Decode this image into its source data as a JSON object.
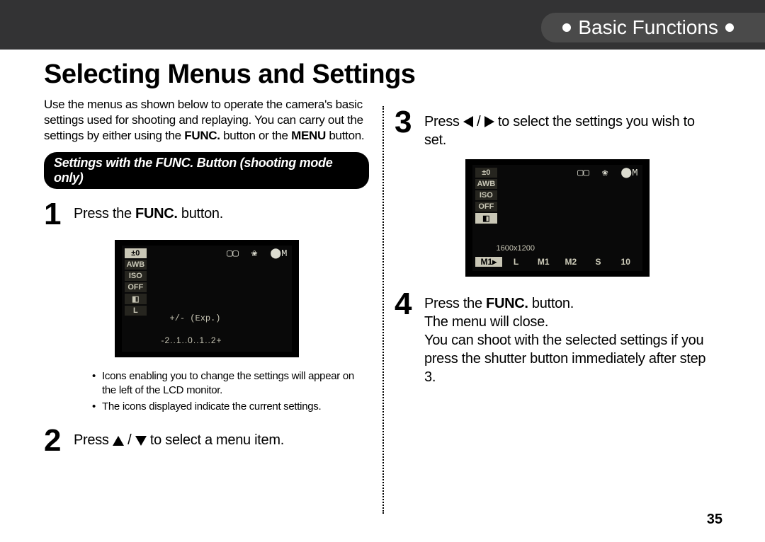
{
  "header": {
    "section": "Basic Functions"
  },
  "title": "Selecting Menus and Settings",
  "intro": {
    "p1a": "Use the menus as shown below to operate the camera's basic settings used for shooting and replaying.  You can carry out the settings by either using the ",
    "func": "FUNC.",
    "p1b": " button or the ",
    "menu": "MENU",
    "p1c": " button."
  },
  "pill": "Settings with the FUNC. Button (shooting mode only)",
  "steps": {
    "s1": {
      "num": "1",
      "a": "Press the ",
      "b": "FUNC.",
      "c": " button."
    },
    "s2": {
      "num": "2",
      "a": "Press ",
      "slash": " / ",
      "b": " to select a menu item."
    },
    "s3": {
      "num": "3",
      "a": "Press ",
      "slash": " / ",
      "b": " to select the settings you wish to set."
    },
    "s4": {
      "num": "4",
      "a": "Press the ",
      "b": "FUNC.",
      "c": " button.",
      "d": "The menu will close.",
      "e": "You can shoot with the selected settings if you press the shutter button immediately after step 3."
    }
  },
  "bullets": {
    "b1": "Icons enabling you to change the settings will appear on the left of the LCD monitor.",
    "b2": "The icons displayed indicate the current settings."
  },
  "lcd1": {
    "icons_left": [
      "±0",
      "AWB",
      "ISO",
      "OFF",
      "◧",
      "L"
    ],
    "tr_icon": "▢▢",
    "right_icons": [
      "❀",
      "⬤M"
    ],
    "exp_label": "+/- (Exp.)",
    "scale": "-2..1..0..1..2+"
  },
  "lcd2": {
    "icons_left": [
      "±0",
      "AWB",
      "ISO",
      "OFF",
      "◧"
    ],
    "tr_icon": "▢▢",
    "right_icons": [
      "❀",
      "⬤M"
    ],
    "size_label": "1600x1200",
    "strip": [
      "M1▸",
      "L",
      "M1",
      "M2",
      "S",
      "10"
    ]
  },
  "page": "35"
}
